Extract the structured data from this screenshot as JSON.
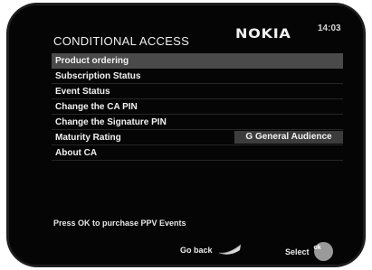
{
  "header": {
    "brand": "NOKIA",
    "time": "14:03",
    "title": "CONDITIONAL ACCESS"
  },
  "menu": {
    "items": [
      {
        "label": "Product ordering",
        "selected": true
      },
      {
        "label": "Subscription Status"
      },
      {
        "label": "Event Status"
      },
      {
        "label": "Change the CA PIN"
      },
      {
        "label": "Change the Signature PIN"
      },
      {
        "label": "Maturity Rating",
        "value": "G General Audience"
      },
      {
        "label": "About CA"
      }
    ]
  },
  "footer": {
    "hint": "Press OK to purchase PPV Events",
    "back_label": "Go back",
    "back_icon": "back-arrow-icon",
    "select_label": "Select",
    "select_icon": "ok-button-icon",
    "ok_text": "ok"
  },
  "colors": {
    "background": "#050505",
    "selected_row": "#4a4a4a",
    "value_box": "#3c3c3c",
    "text": "#f2f2f2"
  }
}
